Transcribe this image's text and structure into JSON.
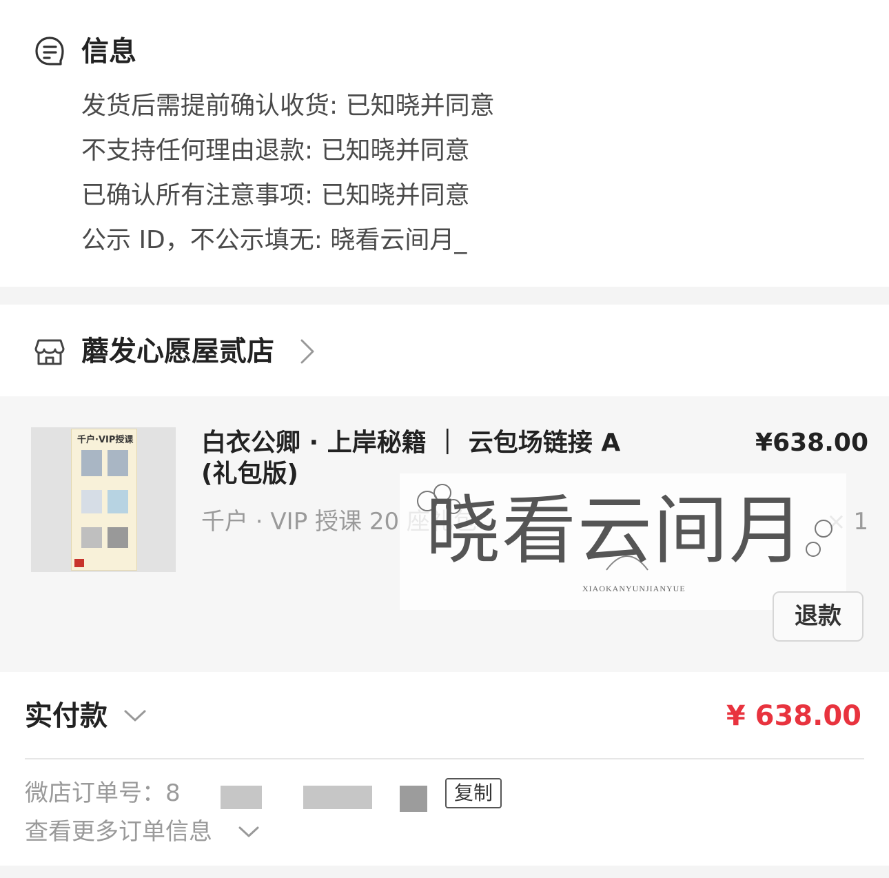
{
  "info": {
    "title": "信息",
    "lines": [
      "发货后需提前确认收货: 已知晓并同意",
      "不支持任何理由退款: 已知晓并同意",
      "已确认所有注意事项: 已知晓并同意",
      "公示 ID，不公示填无: 晓看云间月_"
    ]
  },
  "shop": {
    "name": "蘑发心愿屋贰店"
  },
  "product": {
    "title": "白衣公卿 · 上岸秘籍 ｜ 云包场链接 A (礼包版)",
    "price": "¥638.00",
    "variant": "千户 · VIP 授课 20 座礼包",
    "quantity": "× 1",
    "thumb_text": "千户·VIP授课",
    "refund_label": "退款"
  },
  "watermark": {
    "text": "晓看云间月",
    "subtext": "XIAOKANYUNJIANYUE"
  },
  "payment": {
    "label": "实付款",
    "amount": "¥ 638.00",
    "amount_color": "#e8333e"
  },
  "order": {
    "number_label": "微店订单号：8",
    "copy_label": "复制",
    "more_label": "查看更多订单信息"
  },
  "icons": {
    "info": "message-note-icon",
    "shop": "store-icon",
    "shop_chevron": "chevron-right-icon",
    "pay_chevron": "chevron-down-icon",
    "more_chevron": "chevron-down-icon"
  }
}
